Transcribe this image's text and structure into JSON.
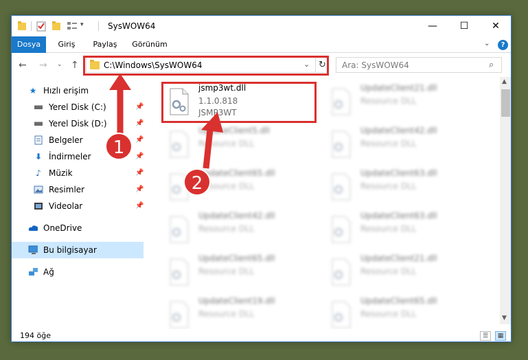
{
  "window": {
    "title": "SysWOW64"
  },
  "ribbon": {
    "tabs": [
      "Dosya",
      "Giriş",
      "Paylaş",
      "Görünüm"
    ]
  },
  "nav": {
    "address": "C:\\Windows\\SysWOW64",
    "search_placeholder": "Ara: SysWOW64"
  },
  "sidebar": {
    "items": [
      {
        "label": "Hızlı erişim",
        "icon": "star-icon"
      },
      {
        "label": "Yerel Disk (C:)",
        "icon": "drive-icon",
        "pinned": true
      },
      {
        "label": "Yerel Disk (D:)",
        "icon": "drive-icon",
        "pinned": true
      },
      {
        "label": "Belgeler",
        "icon": "documents-icon",
        "pinned": true
      },
      {
        "label": "İndirmeler",
        "icon": "download-icon",
        "pinned": true
      },
      {
        "label": "Müzik",
        "icon": "music-icon",
        "pinned": true
      },
      {
        "label": "Resimler",
        "icon": "pictures-icon",
        "pinned": true
      },
      {
        "label": "Videolar",
        "icon": "videos-icon",
        "pinned": true
      },
      {
        "label": "OneDrive",
        "icon": "cloud-icon"
      },
      {
        "label": "Bu bilgisayar",
        "icon": "computer-icon",
        "selected": true
      },
      {
        "label": "Ağ",
        "icon": "network-icon"
      }
    ]
  },
  "files": {
    "highlighted": {
      "name": "jsmp3wt.dll",
      "version": "1.1.0.818",
      "description": "JSMP3WT"
    },
    "blurred": [
      {
        "name": "UpdateClient21.dll",
        "description": "Resource DLL"
      },
      {
        "name": "UpdateClient5.dll",
        "description": "Resource DLL"
      },
      {
        "name": "UpdateClient42.dll",
        "description": "Resource DLL"
      },
      {
        "name": "UpdateClient65.dll",
        "description": "Resource DLL"
      },
      {
        "name": "UpdateClient63.dll",
        "description": "Resource DLL"
      },
      {
        "name": "UpdateClient42.dll",
        "description": "Resource DLL"
      },
      {
        "name": "UpdateClient63.dll",
        "description": "Resource DLL"
      },
      {
        "name": "UpdateClient65.dll",
        "description": "Resource DLL"
      },
      {
        "name": "UpdateClient21.dll",
        "description": "Resource DLL"
      },
      {
        "name": "UpdateClient19.dll",
        "description": "Resource DLL"
      },
      {
        "name": "UpdateClient65.dll",
        "description": "Resource DLL"
      }
    ]
  },
  "status": {
    "item_count": "194 öğe"
  },
  "annotations": {
    "step1": "1",
    "step2": "2",
    "color": "#d9312f"
  }
}
